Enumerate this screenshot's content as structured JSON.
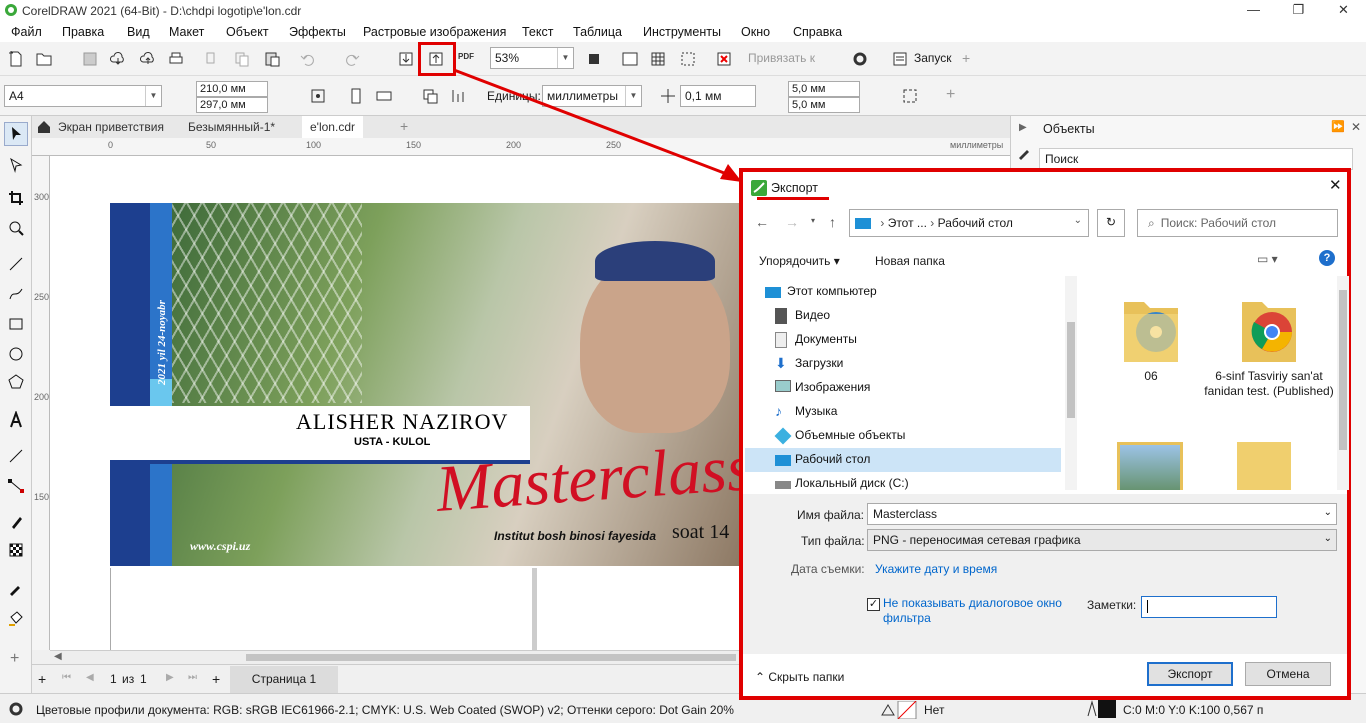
{
  "window": {
    "title": "CorelDRAW 2021 (64-Bit) - D:\\chdpi logotip\\e'lon.cdr",
    "minimize": "—",
    "restore": "❐",
    "close": "✕"
  },
  "menu": [
    "Файл",
    "Правка",
    "Вид",
    "Макет",
    "Объект",
    "Эффекты",
    "Растровые изображения",
    "Текст",
    "Таблица",
    "Инструменты",
    "Окно",
    "Справка"
  ],
  "toolbar": {
    "zoom": "53%",
    "snap_label": "Привязать к",
    "launch_label": "Запуск",
    "pdf_label": "PDF"
  },
  "property_bar": {
    "page_size": "A4",
    "width": "210,0 мм",
    "height": "297,0 мм",
    "units_label": "Единицы:",
    "units": "миллиметры",
    "nudge": "0,1 мм",
    "dup_x": "5,0 мм",
    "dup_y": "5,0 мм"
  },
  "doc_tabs": [
    "Экран приветствия",
    "Безымянный-1*",
    "e'lon.cdr"
  ],
  "ruler": {
    "unit": "миллиметры",
    "h_ticks": [
      "0",
      "50",
      "100",
      "150",
      "200",
      "250"
    ],
    "v_ticks": [
      "300",
      "250",
      "200",
      "150"
    ]
  },
  "banner": {
    "date": "2021 yil 24-noyabr",
    "name": "ALISHER NAZIROV",
    "role": "USTA - KULOL",
    "script": "Masterclass",
    "location": "Institut bosh binosi fayesida",
    "time": "soat 14",
    "site": "www.cspi.uz"
  },
  "page_nav": {
    "current": "1",
    "of_label": "из",
    "total": "1",
    "page_tab": "Страница 1"
  },
  "status": {
    "profiles": "Цветовые профили документа: RGB: sRGB IEC61966-2.1; CMYK: U.S. Web Coated (SWOP) v2; Оттенки серого: Dot Gain 20%",
    "fill": "Нет",
    "outline": "C:0 M:0 Y:0 K:100  0,567 п"
  },
  "objects_panel": {
    "title": "Объекты",
    "search": "Поиск"
  },
  "dialog": {
    "title": "Экспорт",
    "path": [
      "Этот ...",
      "Рабочий стол"
    ],
    "search_placeholder": "Поиск: Рабочий стол",
    "organize": "Упорядочить",
    "new_folder": "Новая папка",
    "nav": [
      "Этот компьютер",
      "Видео",
      "Документы",
      "Загрузки",
      "Изображения",
      "Музыка",
      "Объемные объекты",
      "Рабочий стол",
      "Локальный диск (C:)"
    ],
    "files": [
      {
        "name": "06"
      },
      {
        "name": "6-sinf Tasviriy san'at fanidan test. (Published)"
      }
    ],
    "filename_label": "Имя файла:",
    "filename": "Masterclass",
    "filetype_label": "Тип файла:",
    "filetype": "PNG - переносимая сетевая графика",
    "date_label": "Дата съемки:",
    "date_link": "Укажите дату и время",
    "checkbox_label": "Не показывать диалоговое окно фильтра",
    "notes_label": "Заметки:",
    "hide_folders": "Скрыть папки",
    "export_btn": "Экспорт",
    "cancel_btn": "Отмена"
  },
  "colors": {
    "annotation": "#e00000",
    "selection": "#cce4f7",
    "link": "#0066cc"
  }
}
